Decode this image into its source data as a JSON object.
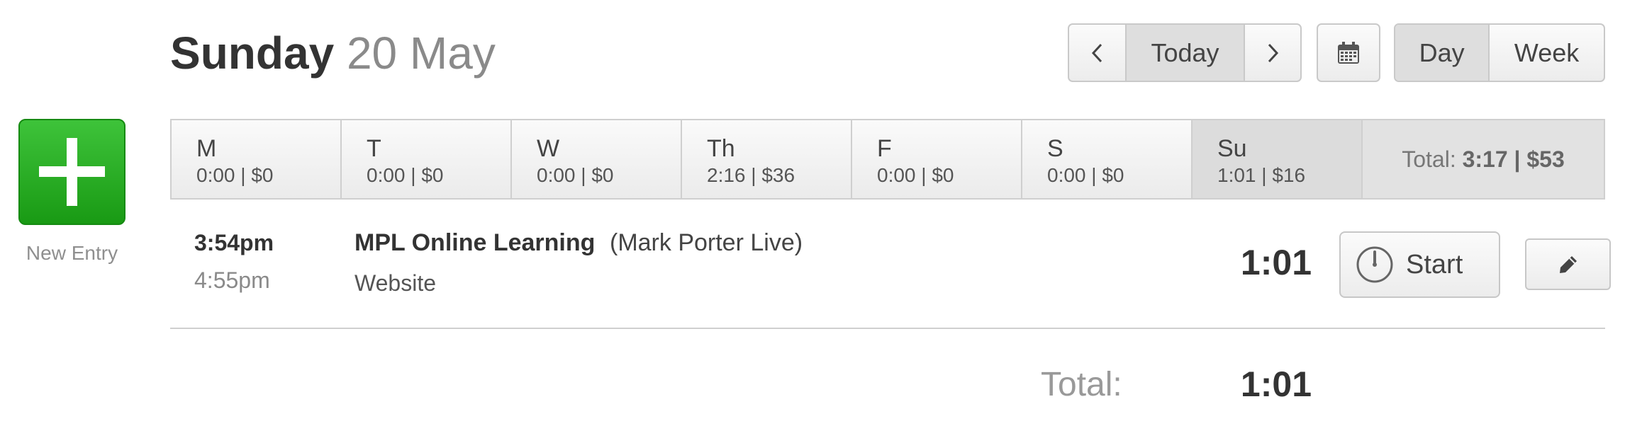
{
  "header": {
    "day": "Sunday",
    "date": "20 May",
    "nav": {
      "prev_icon": "chevron-left-icon",
      "today_label": "Today",
      "next_icon": "chevron-right-icon"
    },
    "calendar_icon": "calendar-icon",
    "views": {
      "day_label": "Day",
      "week_label": "Week",
      "active": "Day"
    }
  },
  "new_entry": {
    "icon": "plus-icon",
    "label": "New Entry",
    "color": "#1fa51a"
  },
  "week": {
    "days": [
      {
        "label": "M",
        "stats": "0:00 | $0",
        "active": false
      },
      {
        "label": "T",
        "stats": "0:00 | $0",
        "active": false
      },
      {
        "label": "W",
        "stats": "0:00 | $0",
        "active": false
      },
      {
        "label": "Th",
        "stats": "2:16 | $36",
        "active": false
      },
      {
        "label": "F",
        "stats": "0:00 | $0",
        "active": false
      },
      {
        "label": "S",
        "stats": "0:00 | $0",
        "active": false
      },
      {
        "label": "Su",
        "stats": "1:01 | $16",
        "active": true
      }
    ],
    "total_label": "Total:",
    "total_value": "3:17 | $53"
  },
  "entries": [
    {
      "start": "3:54pm",
      "end": "4:55pm",
      "project": "MPL Online Learning",
      "client": "(Mark Porter Live)",
      "task": "Website",
      "duration": "1:01",
      "start_button": "Start",
      "timer_icon": "stopwatch-icon",
      "edit_icon": "pencil-icon"
    }
  ],
  "footer": {
    "total_label": "Total:",
    "total_value": "1:01"
  }
}
